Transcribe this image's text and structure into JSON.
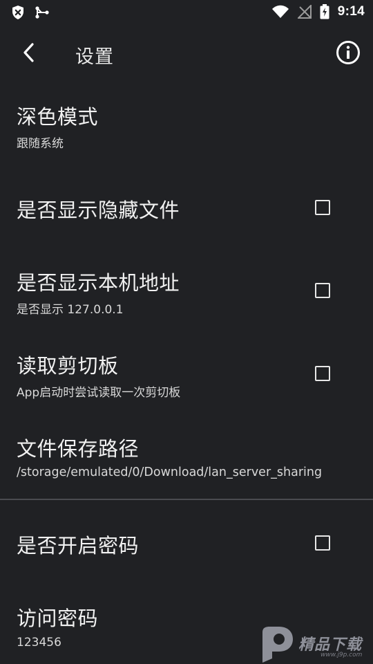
{
  "status_bar": {
    "time": "9:14",
    "left_icons": [
      "shield-x-icon",
      "share-node-icon"
    ],
    "right_icons": [
      "wifi-icon",
      "no-signal-icon",
      "battery-charging-icon"
    ]
  },
  "app_bar": {
    "title": "设置",
    "back_icon": "chevron-left-icon",
    "info_icon": "info-circle-icon"
  },
  "settings": [
    {
      "key": "dark_mode",
      "title": "深色模式",
      "subtitle": "跟随系统",
      "has_checkbox": false
    },
    {
      "key": "show_hidden",
      "title": "是否显示隐藏文件",
      "subtitle": "",
      "has_checkbox": true,
      "checked": false
    },
    {
      "key": "show_local",
      "title": "是否显示本机地址",
      "subtitle": "是否显示 127.0.0.1",
      "has_checkbox": true,
      "checked": false
    },
    {
      "key": "clipboard",
      "title": "读取剪切板",
      "subtitle": "App启动时尝试读取一次剪切板",
      "has_checkbox": true,
      "checked": false
    },
    {
      "key": "save_path",
      "title": "文件保存路径",
      "subtitle": "/storage/emulated/0/Download/lan_server_sharing",
      "has_checkbox": false
    },
    {
      "key": "enable_password",
      "title": "是否开启密码",
      "subtitle": "",
      "has_checkbox": true,
      "checked": false
    },
    {
      "key": "access_password",
      "title": "访问密码",
      "subtitle": "123456",
      "has_checkbox": false
    }
  ],
  "watermark": {
    "text": "精品下载",
    "url": "www.j9p.com",
    "logo_icon": "p-logo-icon"
  },
  "colors": {
    "background": "#202124",
    "divider": "#4a4b50",
    "text_primary": "#f1f1f1",
    "text_secondary": "#d9d9d9"
  }
}
